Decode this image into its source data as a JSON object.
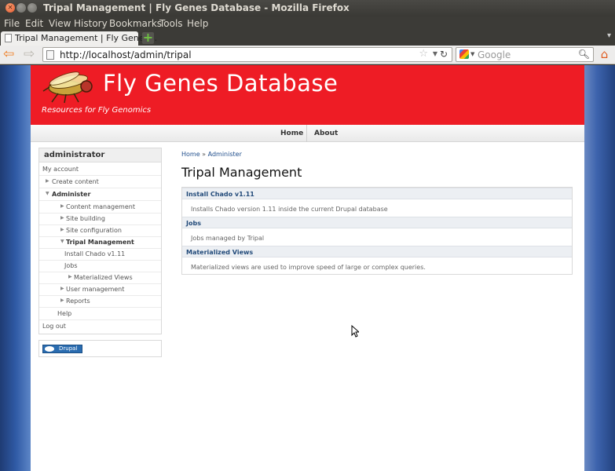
{
  "window": {
    "title": "Tripal Management | Fly Genes Database - Mozilla Firefox"
  },
  "menubar": {
    "items": [
      "File",
      "Edit",
      "View",
      "History",
      "Bookmarks",
      "Tools",
      "Help"
    ]
  },
  "tab": {
    "label": "Tripal Management | Fly Genes…"
  },
  "navigation": {
    "url": "http://localhost/admin/tripal",
    "search_placeholder": "Google"
  },
  "site": {
    "name": "Fly Genes Database",
    "slogan": "Resources for Fly Genomics",
    "primary_links": [
      "Home",
      "About"
    ]
  },
  "sidebar": {
    "title": "administrator",
    "items": [
      {
        "label": "My account"
      },
      {
        "label": "Create content"
      },
      {
        "label": "Administer"
      },
      {
        "label": "Content management"
      },
      {
        "label": "Site building"
      },
      {
        "label": "Site configuration"
      },
      {
        "label": "Tripal Management"
      },
      {
        "label": "Install Chado v1.11"
      },
      {
        "label": "Jobs"
      },
      {
        "label": "Materialized Views"
      },
      {
        "label": "User management"
      },
      {
        "label": "Reports"
      },
      {
        "label": "Help"
      },
      {
        "label": "Log out"
      }
    ],
    "powered_by": "Drupal"
  },
  "content": {
    "breadcrumb": {
      "home": "Home",
      "sep": "»",
      "admin": "Administer"
    },
    "title": "Tripal Management",
    "sections": [
      {
        "heading": "Install Chado v1.11",
        "description": "Installs Chado version 1.11 inside the current Drupal database"
      },
      {
        "heading": "Jobs",
        "description": "Jobs managed by Tripal"
      },
      {
        "heading": "Materialized Views",
        "description": "Materialized views are used to improve speed of large or complex queries."
      }
    ]
  },
  "colors": {
    "header_red": "#ee1c25",
    "link_blue": "#1f4e8c"
  }
}
